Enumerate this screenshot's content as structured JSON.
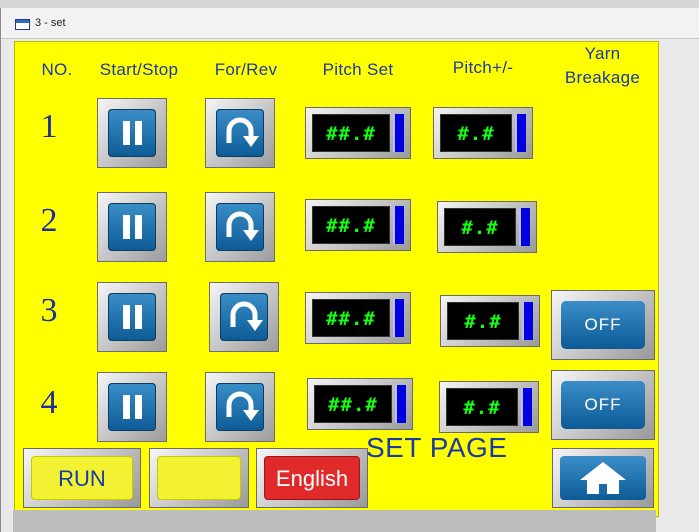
{
  "window": {
    "title": "3 - set"
  },
  "headers": {
    "no": "NO.",
    "start_stop": "Start/Stop",
    "for_rev": "For/Rev",
    "pitch_set": "Pitch Set",
    "pitch_pm": "Pitch+/-",
    "yarn_line1": "Yarn",
    "yarn_line2": "Breakage"
  },
  "rows": [
    {
      "no": "1",
      "pitch_set": "##.#",
      "pitch_pm": "#.#"
    },
    {
      "no": "2",
      "pitch_set": "##.#",
      "pitch_pm": "#.#"
    },
    {
      "no": "3",
      "pitch_set": "##.#",
      "pitch_pm": "#.#",
      "yarn": "OFF"
    },
    {
      "no": "4",
      "pitch_set": "##.#",
      "pitch_pm": "#.#",
      "yarn": "OFF"
    }
  ],
  "footer": {
    "run_label": "RUN",
    "blank_label": "",
    "language_label": "English",
    "page_label": "SET PAGE"
  },
  "icons": {
    "start_stop": "pause-icon",
    "for_rev": "rotate-arrow-icon",
    "home": "home-icon"
  },
  "colors": {
    "panel": "#ffff00",
    "text_blue": "#1a3aa8",
    "button_blue": "#1a6aab",
    "display_green": "#13ff13",
    "language_red": "#e02a2a"
  }
}
